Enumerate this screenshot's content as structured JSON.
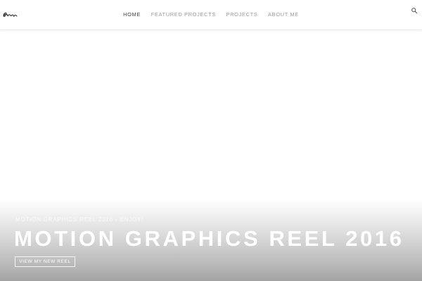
{
  "header": {
    "nav": [
      {
        "label": "HOME",
        "active": true
      },
      {
        "label": "FEATURED PROJECTS",
        "active": false
      },
      {
        "label": "PROJECTS",
        "active": false
      },
      {
        "label": "ABOUT ME",
        "active": false
      }
    ],
    "logo_icon": "signature-logo",
    "search_icon": "search-icon"
  },
  "hero": {
    "subtitle": "MOTION GRAPHICS REEL 2016 - ENJOY!",
    "title": "MOTION GRAPHICS REEL 2016",
    "button_label": "VIEW MY NEW REEL"
  },
  "colors": {
    "nav_active": "#444444",
    "nav_inactive": "#9a9a9a",
    "hero_text": "#ffffff"
  }
}
